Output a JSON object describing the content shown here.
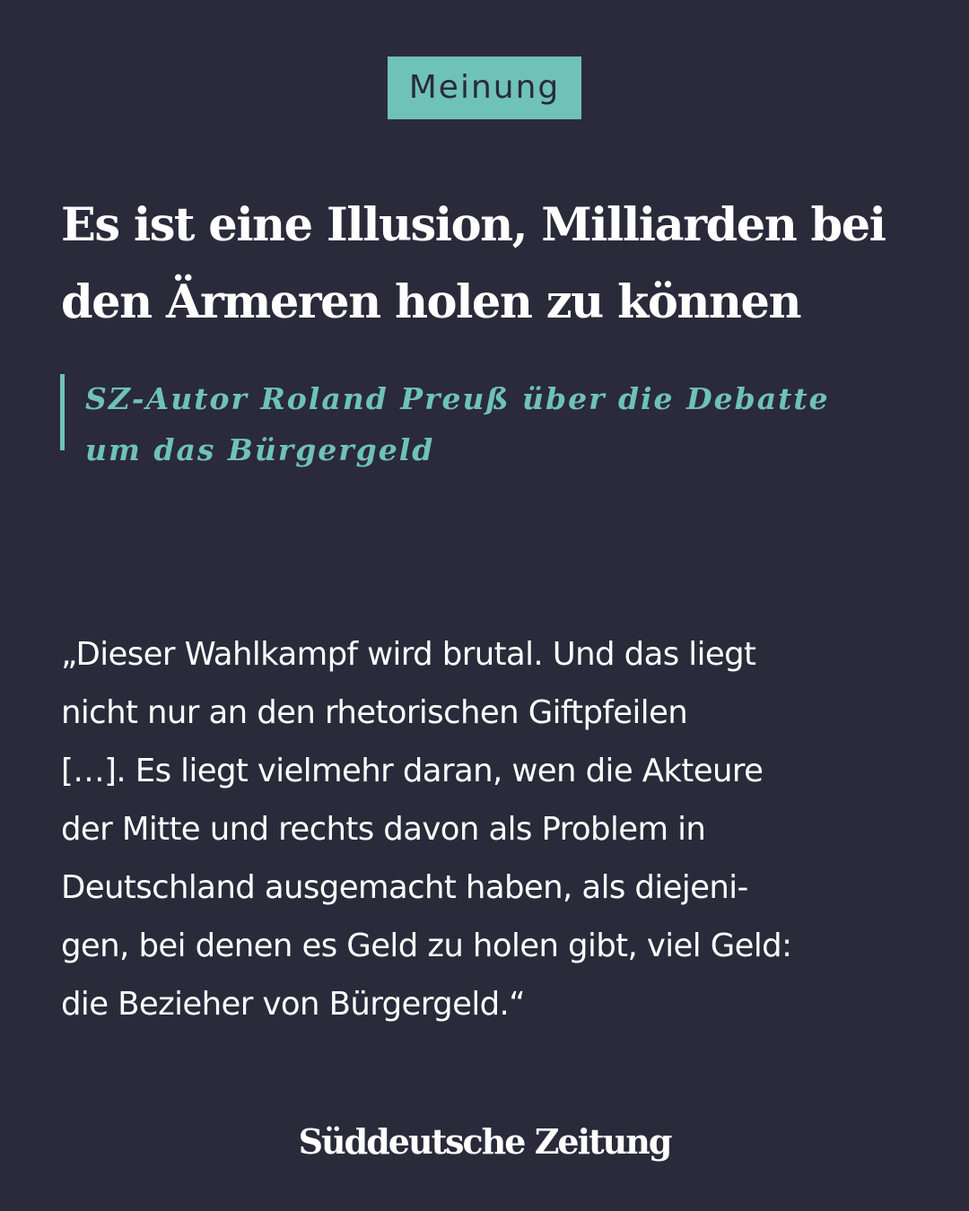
{
  "badge": {
    "label": "Meinung"
  },
  "headline": {
    "text": "Es ist eine Illusion, Milliarden bei den Ärmeren holen zu können"
  },
  "subline": {
    "text": "SZ-Autor Roland Preuß über die Debatte um das Bürgergeld"
  },
  "quote": {
    "text": "„Dieser Wahlkampf wird brutal. Und das liegt\nnicht nur an den rhetorischen Giftpfeilen\n[…]. Es liegt vielmehr daran, wen die Akteure\nder Mitte und rechts davon als Problem in\nDeutschland ausgemacht haben, als diejeni-\ngen, bei denen es Geld zu holen gibt, viel Geld:\ndie Bezieher von Bürgergeld.“"
  },
  "brand": {
    "logo_text": "Süddeutsche Zeitung"
  },
  "colors": {
    "background": "#2a2a3a",
    "accent": "#6fc2b7",
    "text": "#ffffff"
  }
}
